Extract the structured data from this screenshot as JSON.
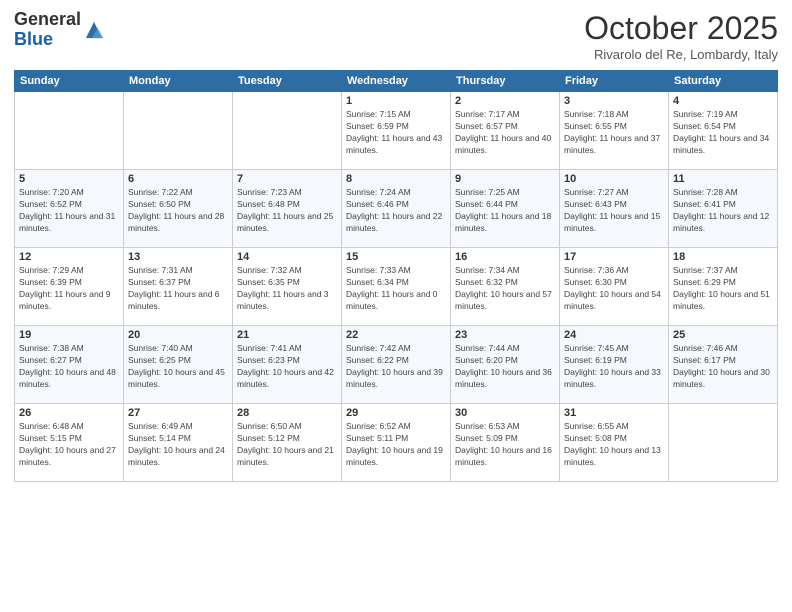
{
  "logo": {
    "general": "General",
    "blue": "Blue"
  },
  "title": "October 2025",
  "location": "Rivarolo del Re, Lombardy, Italy",
  "days_of_week": [
    "Sunday",
    "Monday",
    "Tuesday",
    "Wednesday",
    "Thursday",
    "Friday",
    "Saturday"
  ],
  "weeks": [
    [
      {
        "day": "",
        "info": ""
      },
      {
        "day": "",
        "info": ""
      },
      {
        "day": "",
        "info": ""
      },
      {
        "day": "1",
        "info": "Sunrise: 7:15 AM\nSunset: 6:59 PM\nDaylight: 11 hours and 43 minutes."
      },
      {
        "day": "2",
        "info": "Sunrise: 7:17 AM\nSunset: 6:57 PM\nDaylight: 11 hours and 40 minutes."
      },
      {
        "day": "3",
        "info": "Sunrise: 7:18 AM\nSunset: 6:55 PM\nDaylight: 11 hours and 37 minutes."
      },
      {
        "day": "4",
        "info": "Sunrise: 7:19 AM\nSunset: 6:54 PM\nDaylight: 11 hours and 34 minutes."
      }
    ],
    [
      {
        "day": "5",
        "info": "Sunrise: 7:20 AM\nSunset: 6:52 PM\nDaylight: 11 hours and 31 minutes."
      },
      {
        "day": "6",
        "info": "Sunrise: 7:22 AM\nSunset: 6:50 PM\nDaylight: 11 hours and 28 minutes."
      },
      {
        "day": "7",
        "info": "Sunrise: 7:23 AM\nSunset: 6:48 PM\nDaylight: 11 hours and 25 minutes."
      },
      {
        "day": "8",
        "info": "Sunrise: 7:24 AM\nSunset: 6:46 PM\nDaylight: 11 hours and 22 minutes."
      },
      {
        "day": "9",
        "info": "Sunrise: 7:25 AM\nSunset: 6:44 PM\nDaylight: 11 hours and 18 minutes."
      },
      {
        "day": "10",
        "info": "Sunrise: 7:27 AM\nSunset: 6:43 PM\nDaylight: 11 hours and 15 minutes."
      },
      {
        "day": "11",
        "info": "Sunrise: 7:28 AM\nSunset: 6:41 PM\nDaylight: 11 hours and 12 minutes."
      }
    ],
    [
      {
        "day": "12",
        "info": "Sunrise: 7:29 AM\nSunset: 6:39 PM\nDaylight: 11 hours and 9 minutes."
      },
      {
        "day": "13",
        "info": "Sunrise: 7:31 AM\nSunset: 6:37 PM\nDaylight: 11 hours and 6 minutes."
      },
      {
        "day": "14",
        "info": "Sunrise: 7:32 AM\nSunset: 6:35 PM\nDaylight: 11 hours and 3 minutes."
      },
      {
        "day": "15",
        "info": "Sunrise: 7:33 AM\nSunset: 6:34 PM\nDaylight: 11 hours and 0 minutes."
      },
      {
        "day": "16",
        "info": "Sunrise: 7:34 AM\nSunset: 6:32 PM\nDaylight: 10 hours and 57 minutes."
      },
      {
        "day": "17",
        "info": "Sunrise: 7:36 AM\nSunset: 6:30 PM\nDaylight: 10 hours and 54 minutes."
      },
      {
        "day": "18",
        "info": "Sunrise: 7:37 AM\nSunset: 6:29 PM\nDaylight: 10 hours and 51 minutes."
      }
    ],
    [
      {
        "day": "19",
        "info": "Sunrise: 7:38 AM\nSunset: 6:27 PM\nDaylight: 10 hours and 48 minutes."
      },
      {
        "day": "20",
        "info": "Sunrise: 7:40 AM\nSunset: 6:25 PM\nDaylight: 10 hours and 45 minutes."
      },
      {
        "day": "21",
        "info": "Sunrise: 7:41 AM\nSunset: 6:23 PM\nDaylight: 10 hours and 42 minutes."
      },
      {
        "day": "22",
        "info": "Sunrise: 7:42 AM\nSunset: 6:22 PM\nDaylight: 10 hours and 39 minutes."
      },
      {
        "day": "23",
        "info": "Sunrise: 7:44 AM\nSunset: 6:20 PM\nDaylight: 10 hours and 36 minutes."
      },
      {
        "day": "24",
        "info": "Sunrise: 7:45 AM\nSunset: 6:19 PM\nDaylight: 10 hours and 33 minutes."
      },
      {
        "day": "25",
        "info": "Sunrise: 7:46 AM\nSunset: 6:17 PM\nDaylight: 10 hours and 30 minutes."
      }
    ],
    [
      {
        "day": "26",
        "info": "Sunrise: 6:48 AM\nSunset: 5:15 PM\nDaylight: 10 hours and 27 minutes."
      },
      {
        "day": "27",
        "info": "Sunrise: 6:49 AM\nSunset: 5:14 PM\nDaylight: 10 hours and 24 minutes."
      },
      {
        "day": "28",
        "info": "Sunrise: 6:50 AM\nSunset: 5:12 PM\nDaylight: 10 hours and 21 minutes."
      },
      {
        "day": "29",
        "info": "Sunrise: 6:52 AM\nSunset: 5:11 PM\nDaylight: 10 hours and 19 minutes."
      },
      {
        "day": "30",
        "info": "Sunrise: 6:53 AM\nSunset: 5:09 PM\nDaylight: 10 hours and 16 minutes."
      },
      {
        "day": "31",
        "info": "Sunrise: 6:55 AM\nSunset: 5:08 PM\nDaylight: 10 hours and 13 minutes."
      },
      {
        "day": "",
        "info": ""
      }
    ]
  ]
}
